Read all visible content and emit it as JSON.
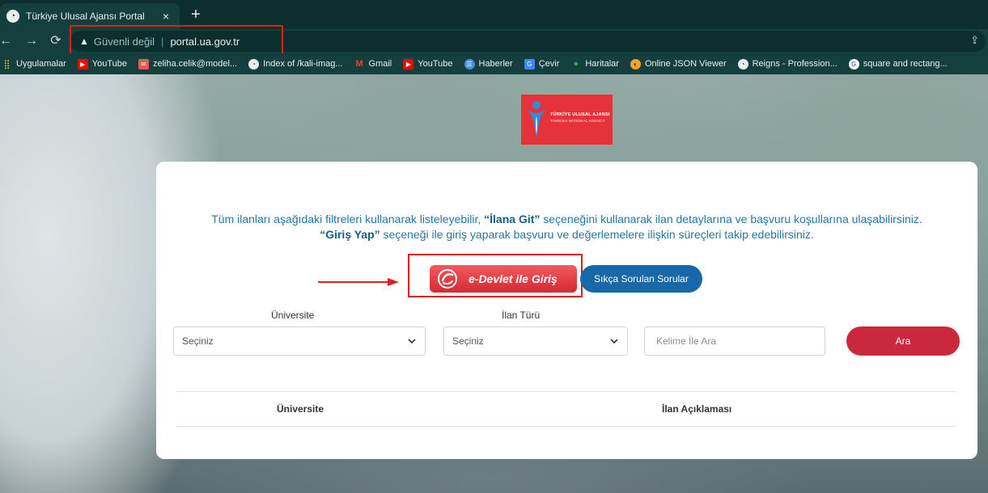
{
  "browser": {
    "tab_title": "Türkiye Ulusal Ajansı Portal",
    "tab_close": "×",
    "new_tab": "+",
    "security_label": "Güvenli değil",
    "url": "portal.ua.gov.tr"
  },
  "bookmarks": [
    {
      "label": "Uygulamalar",
      "icon": "apps-icon"
    },
    {
      "label": "YouTube",
      "icon": "youtube-icon"
    },
    {
      "label": "zeliha.celik@model...",
      "icon": "mail-icon"
    },
    {
      "label": "Index of /kali-imag...",
      "icon": "globe-icon"
    },
    {
      "label": "Gmail",
      "icon": "gmail-icon"
    },
    {
      "label": "YouTube",
      "icon": "youtube-icon"
    },
    {
      "label": "Haberler",
      "icon": "news-icon"
    },
    {
      "label": "Çevir",
      "icon": "translate-icon"
    },
    {
      "label": "Haritalar",
      "icon": "maps-icon"
    },
    {
      "label": "Online JSON Viewer",
      "icon": "json-icon"
    },
    {
      "label": "Reigns - Profession...",
      "icon": "globe-icon"
    },
    {
      "label": "square and rectang...",
      "icon": "google-icon"
    }
  ],
  "logo": {
    "line1": "TÜRKİYE ULUSAL AJANSI",
    "line2": "TURKISH NATIONAL AGENCY"
  },
  "intro": {
    "part1": "Tüm ilanları aşağıdaki filtreleri kullanarak listeleyebilir, ",
    "bold1": "“İlana Git”",
    "part2": " seçeneğini kullanarak ilan detaylarına ve başvuru koşullarına ulaşabilirsiniz.",
    "bold2": "“Giriş Yap”",
    "part3": " seçeneği ile giriş yaparak başvuru ve değerlemelere ilişkin süreçleri takip edebilirsiniz."
  },
  "buttons": {
    "edevlet": "e-Devlet ile Giriş",
    "faq": "Sıkça Sorulan Sorular",
    "search": "Ara"
  },
  "filters": {
    "university_label": "Üniversite",
    "university_value": "Seçiniz",
    "type_label": "İlan Türü",
    "type_value": "Seçiniz",
    "keyword_placeholder": "Kelime İle Ara"
  },
  "table": {
    "columns": [
      "Üniversite",
      "İlan Açıklaması"
    ]
  },
  "colors": {
    "annotation": "#e0201c",
    "brand_red": "#e63238",
    "faq_blue": "#1668a8",
    "search_red": "#c9283d"
  }
}
